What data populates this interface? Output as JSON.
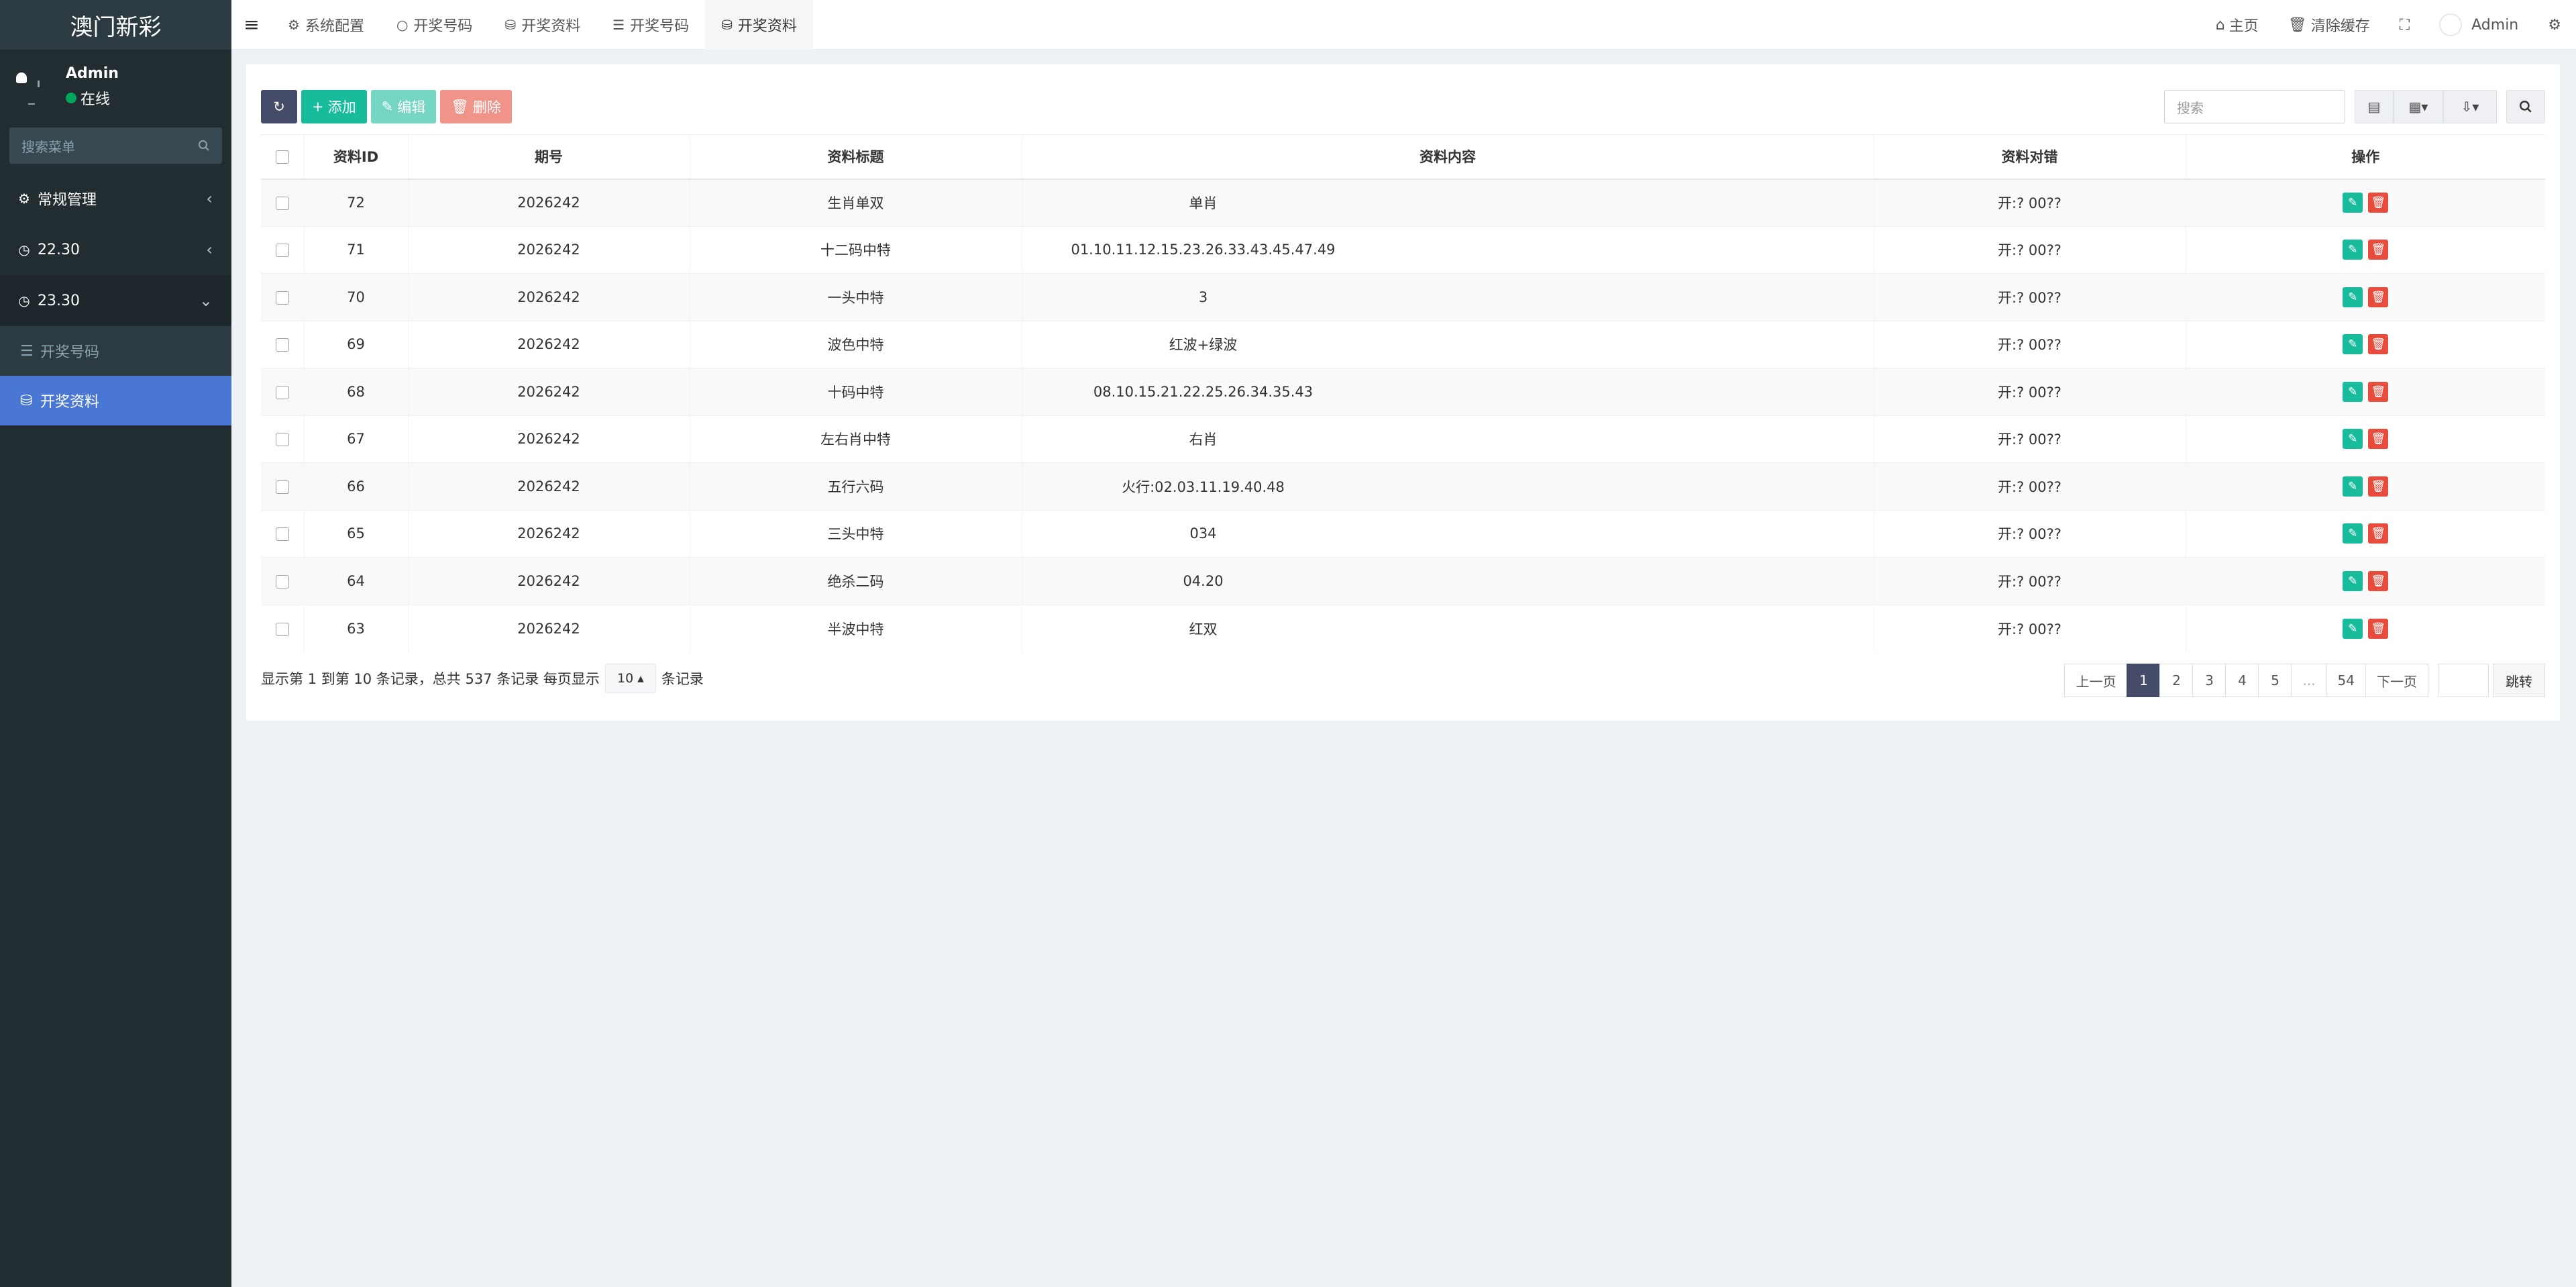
{
  "app": {
    "title": "澳门新彩"
  },
  "user": {
    "name": "Admin",
    "status": "在线"
  },
  "sidebar": {
    "search_placeholder": "搜索菜单",
    "items": [
      {
        "label": "常规管理",
        "icon": "cogs-icon",
        "arrow": "‹"
      },
      {
        "label": "22.30",
        "icon": "clock-icon",
        "arrow": "‹"
      },
      {
        "label": "23.30",
        "icon": "clock-icon",
        "arrow": "⌄"
      }
    ],
    "subitems": [
      {
        "label": "开奖号码",
        "icon": "list-icon"
      },
      {
        "label": "开奖资料",
        "icon": "database-icon"
      }
    ]
  },
  "topbar": {
    "tabs": [
      {
        "label": "系统配置",
        "icon": "gear-icon"
      },
      {
        "label": "开奖号码",
        "icon": "circle-icon"
      },
      {
        "label": "开奖资料",
        "icon": "database-icon"
      },
      {
        "label": "开奖号码",
        "icon": "list-icon"
      },
      {
        "label": "开奖资料",
        "icon": "database-icon"
      }
    ],
    "home": "主页",
    "clear_cache": "清除缓存",
    "admin": "Admin"
  },
  "toolbar": {
    "add": "添加",
    "edit": "编辑",
    "delete": "删除",
    "search_placeholder": "搜索"
  },
  "table": {
    "headers": [
      "资料ID",
      "期号",
      "资料标题",
      "资料内容",
      "资料对错",
      "操作"
    ],
    "rows": [
      {
        "id": "72",
        "period": "2026242",
        "title": "生肖单双",
        "content": "单肖",
        "result": "开:?  00??"
      },
      {
        "id": "71",
        "period": "2026242",
        "title": "十二码中特",
        "content": "01.10.11.12.15.23.26.33.43.45.47.49",
        "result": "开:?  00??"
      },
      {
        "id": "70",
        "period": "2026242",
        "title": "一头中特",
        "content": "3",
        "result": "开:?  00??"
      },
      {
        "id": "69",
        "period": "2026242",
        "title": "波色中特",
        "content": "红波+绿波",
        "result": "开:?  00??"
      },
      {
        "id": "68",
        "period": "2026242",
        "title": "十码中特",
        "content": "08.10.15.21.22.25.26.34.35.43",
        "result": "开:?  00??"
      },
      {
        "id": "67",
        "period": "2026242",
        "title": "左右肖中特",
        "content": "右肖",
        "result": "开:?  00??"
      },
      {
        "id": "66",
        "period": "2026242",
        "title": "五行六码",
        "content": "火行:02.03.11.19.40.48",
        "result": "开:?  00??"
      },
      {
        "id": "65",
        "period": "2026242",
        "title": "三头中特",
        "content": "034",
        "result": "开:?  00??"
      },
      {
        "id": "64",
        "period": "2026242",
        "title": "绝杀二码",
        "content": "04.20",
        "result": "开:?  00??"
      },
      {
        "id": "63",
        "period": "2026242",
        "title": "半波中特",
        "content": "红双",
        "result": "开:?  00??"
      }
    ]
  },
  "pagination": {
    "summary": "显示第 1 到第 10 条记录，总共 537 条记录 每页显示",
    "page_size": "10",
    "suffix": "条记录",
    "prev": "上一页",
    "pages": [
      "1",
      "2",
      "3",
      "4",
      "5",
      "...",
      "54"
    ],
    "next": "下一页",
    "jump": "跳转"
  }
}
